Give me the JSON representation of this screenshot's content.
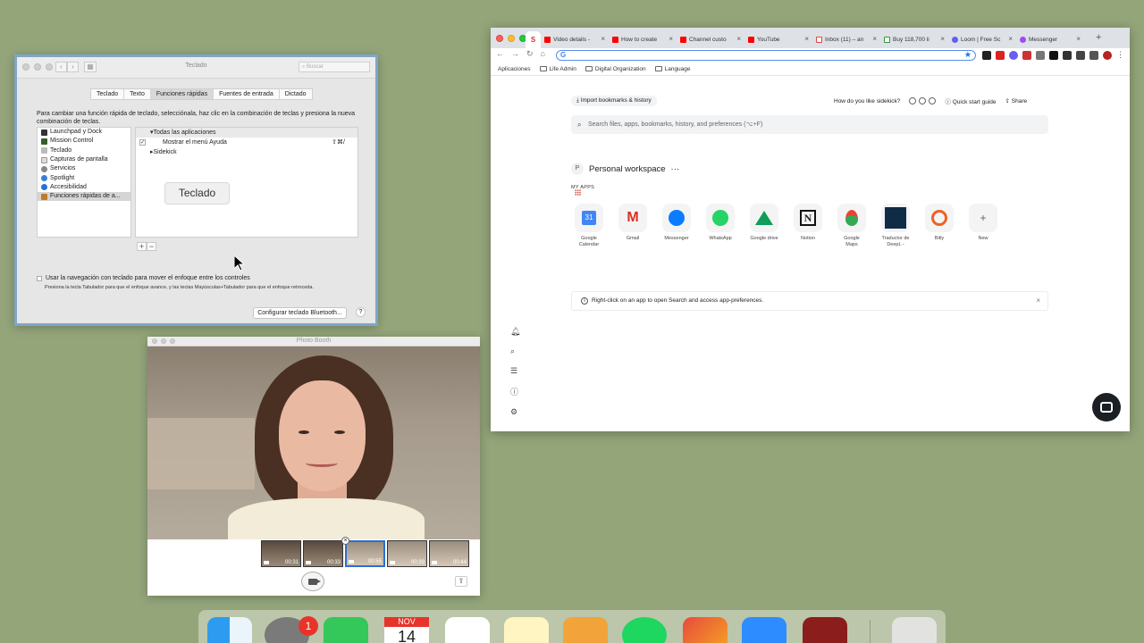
{
  "prefs": {
    "title": "Teclado",
    "search_placeholder": "Buscar",
    "tabs": [
      "Teclado",
      "Texto",
      "Funciones rápidas",
      "Fuentes de entrada",
      "Dictado"
    ],
    "description": "Para cambiar una función rápida de teclado, selecciónala, haz clic en la combinación de teclas y presiona la nueva combinación de teclas.",
    "categories": [
      "Launchpad y Dock",
      "Mission Control",
      "Teclado",
      "Capturas de pantalla",
      "Servicios",
      "Spotlight",
      "Accesibilidad",
      "Funciones rápidas de a..."
    ],
    "shortcuts": {
      "group1": "Todas las aplicaciones",
      "item1": "Mostrar el menú Ayuda",
      "item1_keys": "⇧⌘/",
      "group2": "Sidekick"
    },
    "tooltip": "Teclado",
    "kbnav_label": "Usar la navegación con teclado para mover el enfoque entre los controles",
    "kbnav_note": "Presiona la tecla Tabulador para que el enfoque avance, y las teclas Mayúsculas+Tabulador para que el enfoque retroceda.",
    "bluetooth_button": "Configurar teclado Bluetooth...",
    "help": "?"
  },
  "booth": {
    "title": "Photo Booth",
    "thumbs": [
      "00:31",
      "00:33",
      "00:55",
      "00:39",
      "00:44"
    ]
  },
  "chrome": {
    "tabs": [
      "Video details -",
      "How to create",
      "Channel custo",
      "YouTube",
      "Inbox (11) – an",
      "Buy 118,700 li",
      "Loom | Free Sc",
      "Messenger"
    ],
    "bookmarks": [
      "Aplicaciones",
      "Life Admin",
      "Digital Organization",
      "Language"
    ],
    "omnibox_letter": "G"
  },
  "sidekick": {
    "import": "Import bookmarks & history",
    "like_question": "How do you like sidekick?",
    "quick_start": "Quick start guide",
    "share": "Share",
    "search_placeholder": "Search files, apps, bookmarks, history, and preferences (⌥+F)",
    "workspace_initial": "P",
    "workspace": "Personal workspace",
    "workspace_more": "···",
    "my_apps": "MY APPS",
    "apps": [
      "Google Calendar",
      "Gmail",
      "Messenger",
      "WhatsApp",
      "Google drive",
      "Notion",
      "Google Maps",
      "Traductor de DeepL -",
      "Bitly",
      "New"
    ],
    "calendar_day": "31",
    "hint": "Right-click on an app to open Search and access app-preferences."
  },
  "dock": {
    "badge": "1",
    "calendar_month": "NOV",
    "calendar_day": "14"
  },
  "colors": {
    "desktop": "#94a57a",
    "focus_ring": "#7fa6c9",
    "badge": "#e8332a"
  }
}
